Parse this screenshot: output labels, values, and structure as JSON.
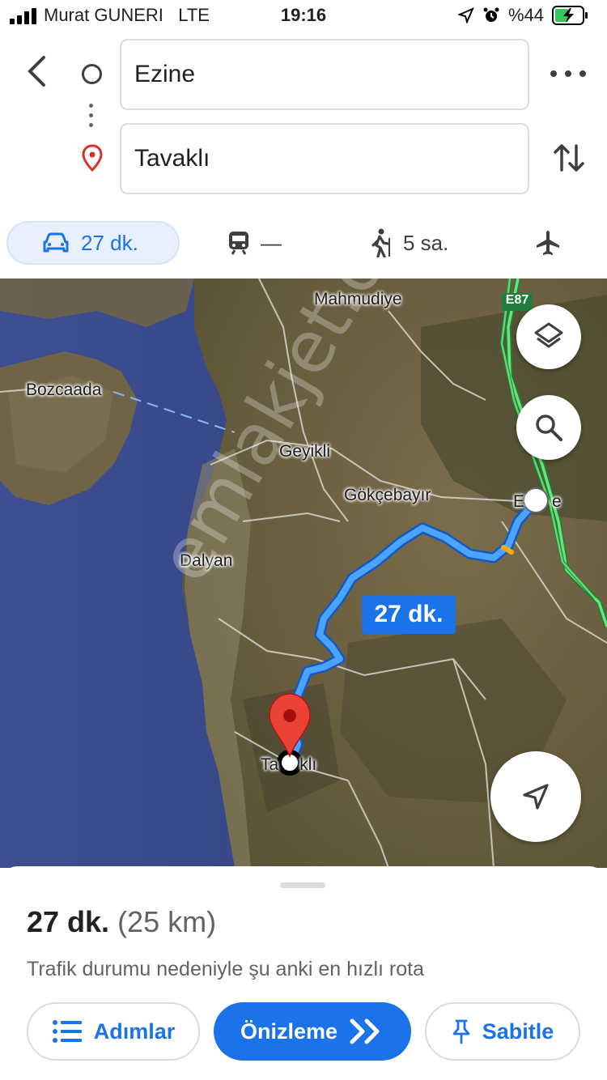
{
  "status_bar": {
    "carrier": "Murat GUNERI",
    "network": "LTE",
    "time": "19:16",
    "battery": "%44"
  },
  "directions": {
    "origin": "Ezine",
    "destination": "Tavaklı"
  },
  "modes": {
    "car": "27 dk.",
    "transit": "—",
    "walk": "5 sa."
  },
  "map": {
    "places": {
      "mahmudiye": "Mahmudiye",
      "bozcaada": "Bozcaada",
      "geyikli": "Geyikli",
      "gokcebayir": "Gökçebayır",
      "dalyan": "Dalyan",
      "ezine_partial": "E",
      "ezine_partial2": "e",
      "tavakli_partial": "Ta",
      "tavakli_partial2": "klı"
    },
    "highway_shield": "E87",
    "route_label": "27 dk.",
    "watermark": "emlakjet.com",
    "colors": {
      "route": "#4285f4",
      "highway": "#34c759",
      "pin": "#ea4335"
    }
  },
  "sheet": {
    "duration": "27 dk.",
    "distance": "(25 km)",
    "reason": "Trafik durumu nedeniyle şu anki en hızlı rota",
    "steps_label": "Adımlar",
    "preview_label": "Önizleme",
    "pin_label": "Sabitle"
  }
}
